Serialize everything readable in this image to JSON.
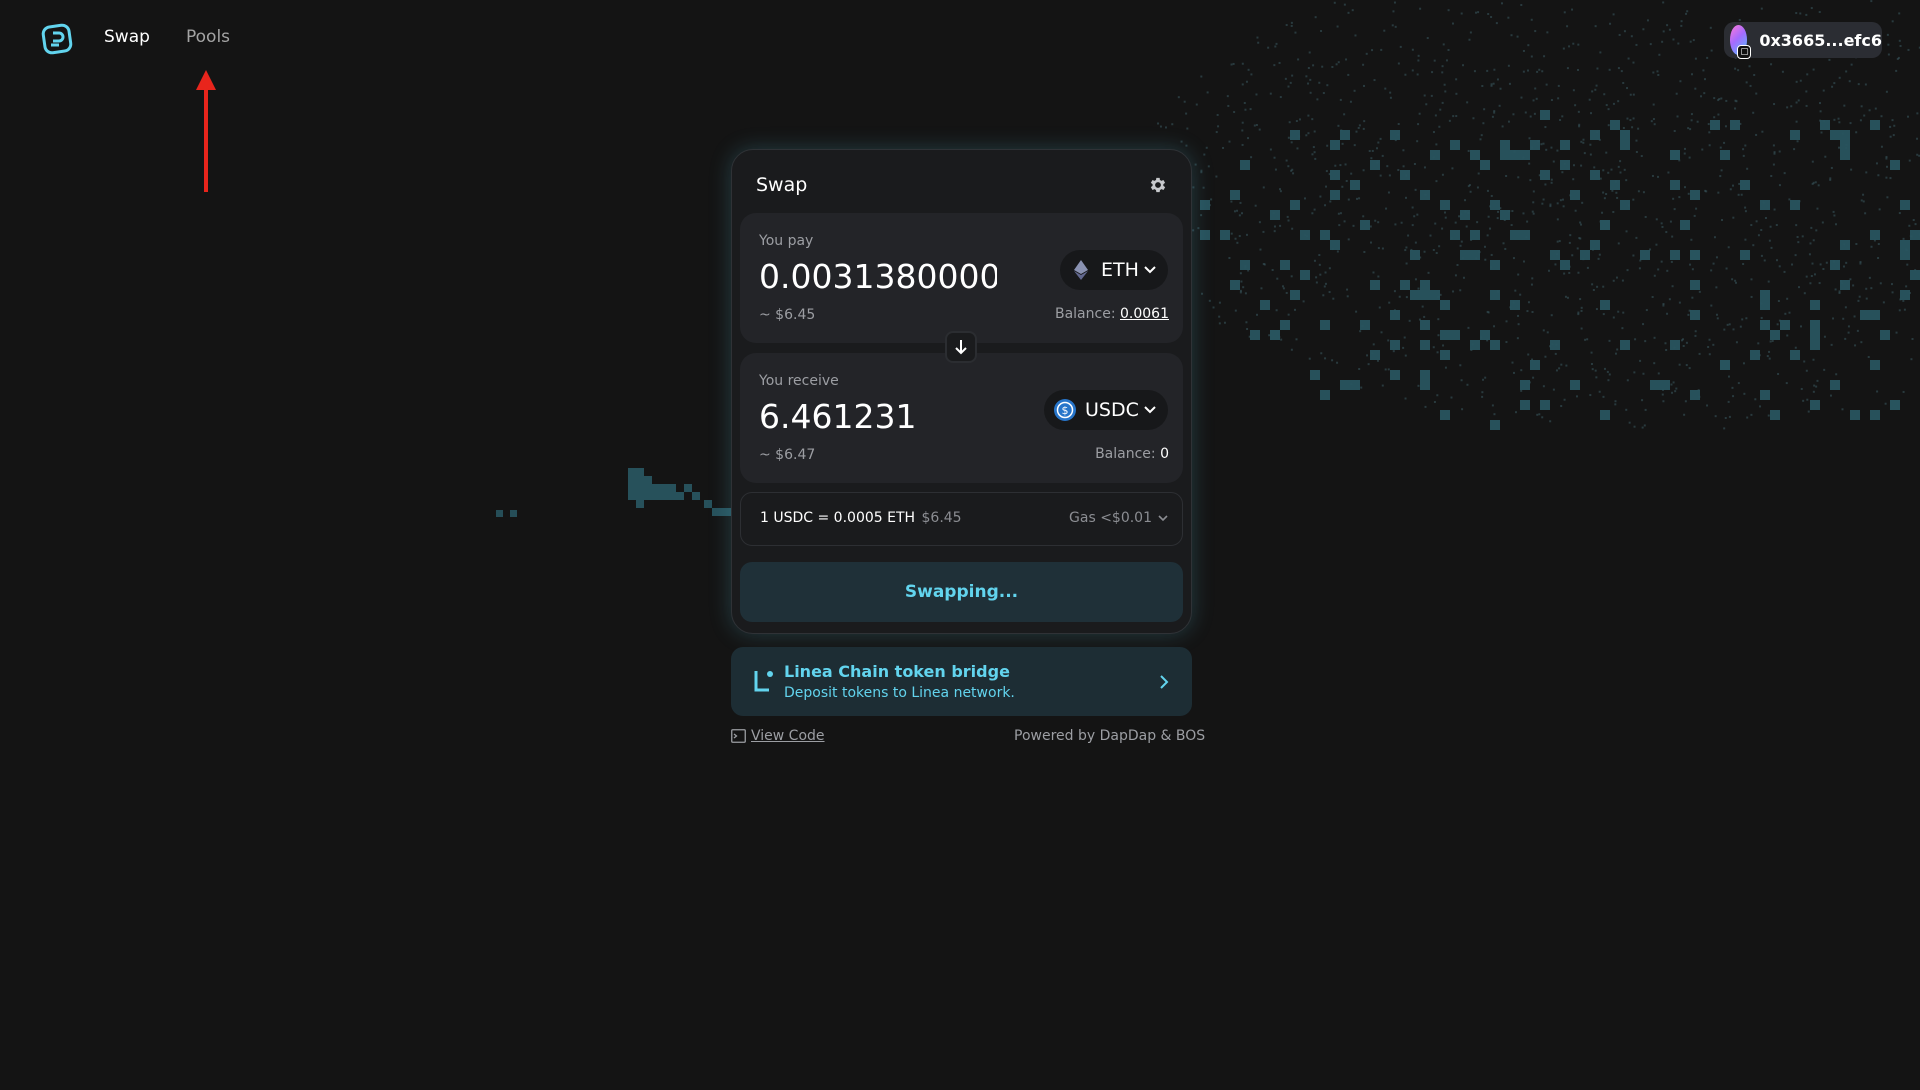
{
  "nav": {
    "items": [
      {
        "label": "Swap",
        "active": true
      },
      {
        "label": "Pools",
        "active": false
      }
    ]
  },
  "wallet": {
    "address": "0x3665...efc6"
  },
  "swap_card": {
    "title": "Swap",
    "pay": {
      "label": "You pay",
      "amount": "0.003138000000",
      "usd": "~ $6.45",
      "token": "ETH",
      "balance_label": "Balance: ",
      "balance_value": "0.0061"
    },
    "receive": {
      "label": "You receive",
      "amount": "6.461231",
      "usd": "~ $6.47",
      "token": "USDC",
      "balance_label": "Balance: ",
      "balance_value": "0"
    },
    "rate_text": "1 USDC = 0.0005 ETH",
    "rate_usd": "$6.45",
    "gas": "Gas <$0.01",
    "button_label": "Swapping..."
  },
  "bridge": {
    "title": "Linea Chain token bridge",
    "subtitle": "Deposit tokens to Linea network."
  },
  "footer": {
    "view_code": "View Code",
    "powered_by": "Powered by DapDap & BOS"
  },
  "colors": {
    "background": "#141414",
    "accent": "#62d4ee",
    "pixel_art": "#28545f",
    "annotation_arrow": "#e8251c"
  },
  "icons": [
    "logo-icon",
    "gear-icon",
    "eth-icon",
    "usdc-icon",
    "chevron-down-icon",
    "arrow-down-icon",
    "linea-icon",
    "chevron-right-icon",
    "terminal-icon",
    "annotation-arrow-icon"
  ]
}
